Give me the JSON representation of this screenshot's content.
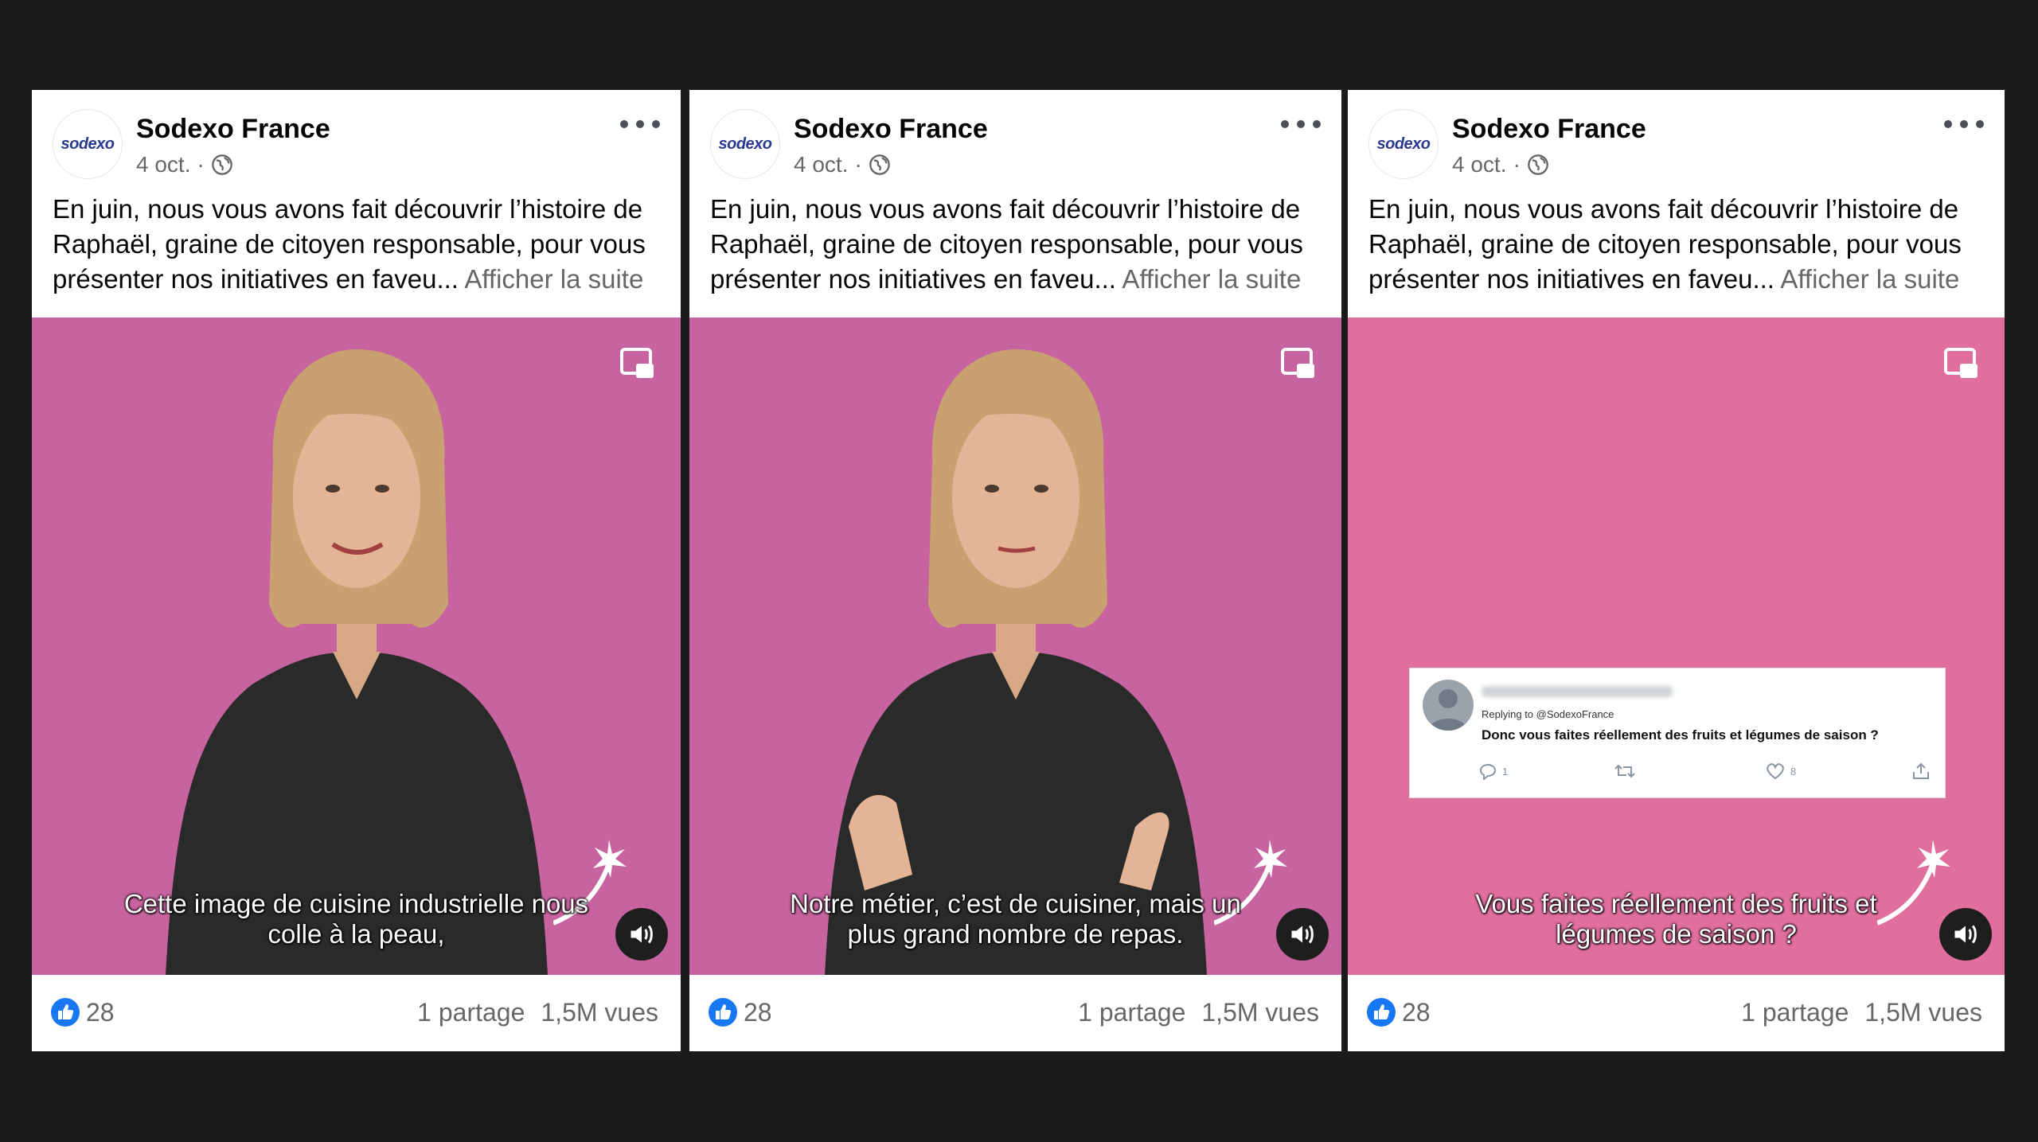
{
  "posts": [
    {
      "page_name": "Sodexo France",
      "avatar_text": "sodexo",
      "date": "4 oct.",
      "separator": "·",
      "text": "En juin, nous vous avons fait découvrir l’histoire de Raphaël, graine de citoyen responsable, pour vous présenter nos initiatives en faveu...",
      "see_more": "Afficher la suite",
      "subtitle": "Cette image de cuisine industrielle nous colle à la peau,",
      "likes": "28",
      "shares": "1 partage",
      "views": "1,5M vues"
    },
    {
      "page_name": "Sodexo France",
      "avatar_text": "sodexo",
      "date": "4 oct.",
      "separator": "·",
      "text": "En juin, nous vous avons fait découvrir l’histoire de Raphaël, graine de citoyen responsable, pour vous présenter nos initiatives en faveu...",
      "see_more": "Afficher la suite",
      "subtitle": "Notre métier, c’est de cuisiner, mais un plus grand nombre de repas.",
      "likes": "28",
      "shares": "1 partage",
      "views": "1,5M vues"
    },
    {
      "page_name": "Sodexo France",
      "avatar_text": "sodexo",
      "date": "4 oct.",
      "separator": "·",
      "text": "En juin, nous vous avons fait découvrir l’histoire de Raphaël, graine de citoyen responsable, pour vous présenter nos initiatives en faveu...",
      "see_more": "Afficher la suite",
      "subtitle": "Vous faites réellement des fruits et légumes de saison ?",
      "likes": "28",
      "shares": "1 partage",
      "views": "1,5M vues",
      "tweet": {
        "reply_to": "Replying to @SodexoFrance",
        "text": "Donc vous faites réellement des fruits et légumes de saison ?",
        "reply_count": "1",
        "like_count": "8"
      }
    }
  ],
  "colors": {
    "video_bg_1": "#c7649f",
    "video_bg_3": "#e16f9e",
    "like_blue": "#1877f2",
    "page_bg": "#1b1b1b"
  },
  "icons": [
    "globe-icon",
    "more-icon",
    "pip-icon",
    "sound-icon",
    "like-icon",
    "reply-icon",
    "retweet-icon",
    "heart-icon",
    "share-icon"
  ]
}
